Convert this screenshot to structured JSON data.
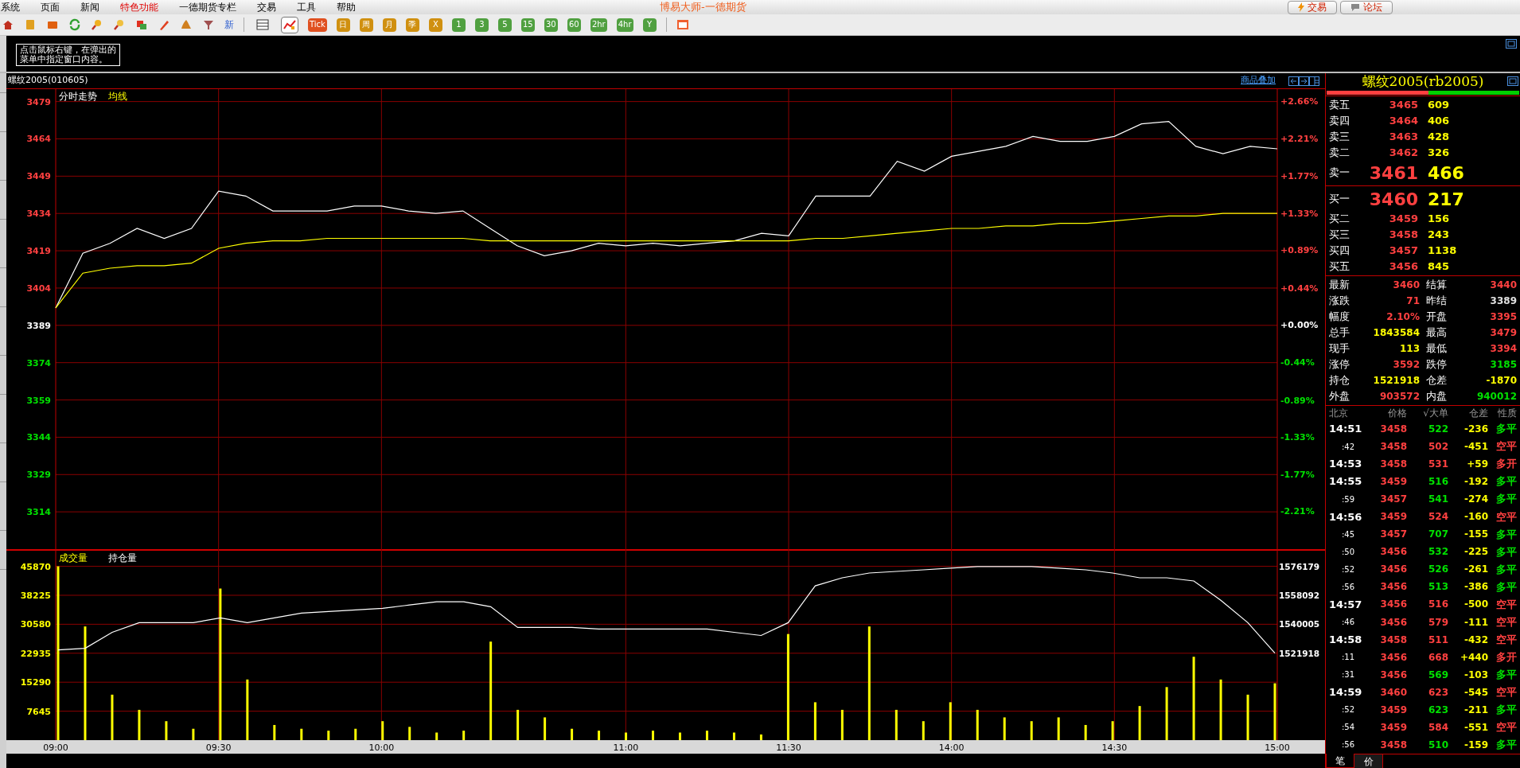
{
  "menu": [
    {
      "label": "系统",
      "highlight": false
    },
    {
      "label": "页面",
      "highlight": false
    },
    {
      "label": "新闻",
      "highlight": false
    },
    {
      "label": "特色功能",
      "highlight": true
    },
    {
      "label": "一德期货专栏",
      "highlight": false
    },
    {
      "label": "交易",
      "highlight": false
    },
    {
      "label": "工具",
      "highlight": false
    },
    {
      "label": "帮助",
      "highlight": false
    }
  ],
  "window": {
    "title": "博易大师-一德期货"
  },
  "top_buttons": [
    {
      "label": "交易",
      "kind": "trade"
    },
    {
      "label": "论坛",
      "kind": "forum"
    }
  ],
  "toolbar": {
    "news_label": "新",
    "views": [
      {
        "selected": false
      },
      {
        "selected": true
      }
    ],
    "periods": [
      {
        "label": "Tick",
        "color": "#e05020"
      },
      {
        "label": "日",
        "color": "#d09010"
      },
      {
        "label": "周",
        "color": "#d09010"
      },
      {
        "label": "月",
        "color": "#d09010"
      },
      {
        "label": "季",
        "color": "#d09010"
      },
      {
        "label": "X",
        "color": "#d09010"
      },
      {
        "label": "1",
        "color": "#50a040"
      },
      {
        "label": "3",
        "color": "#50a040"
      },
      {
        "label": "5",
        "color": "#50a040"
      },
      {
        "label": "15",
        "color": "#50a040"
      },
      {
        "label": "30",
        "color": "#50a040"
      },
      {
        "label": "60",
        "color": "#50a040"
      },
      {
        "label": "2hr",
        "color": "#50a040"
      },
      {
        "label": "4hr",
        "color": "#50a040"
      },
      {
        "label": "Y",
        "color": "#50a040"
      }
    ]
  },
  "tooltip": {
    "lines": [
      "点击鼠标右键，在弹出的",
      "菜单中指定窗口内容。"
    ]
  },
  "chart_header": {
    "title": "螺纹2005(010605)",
    "overlay_link": "商品叠加"
  },
  "price_chart": {
    "chart_data": {
      "type": "line",
      "grid": true,
      "series": [
        {
          "name": "分时走势",
          "color": "#ffffff",
          "values": [
            3396,
            3418,
            3422,
            3428,
            3424,
            3428,
            3443,
            3441,
            3435,
            3435,
            3435,
            3437,
            3437,
            3435,
            3434,
            3435,
            3428,
            3421,
            3417,
            3419,
            3422,
            3421,
            3422,
            3421,
            3422,
            3423,
            3426,
            3425,
            3441,
            3441,
            3441,
            3455,
            3451,
            3457,
            3459,
            3461,
            3465,
            3463,
            3463,
            3465,
            3470,
            3471,
            3461,
            3458,
            3461,
            3460
          ]
        },
        {
          "name": "均线",
          "color": "#ffff00",
          "values": [
            3396,
            3410,
            3412,
            3413,
            3413,
            3414,
            3420,
            3422,
            3423,
            3423,
            3424,
            3424,
            3424,
            3424,
            3424,
            3424,
            3423,
            3423,
            3423,
            3423,
            3423,
            3423,
            3423,
            3423,
            3423,
            3423,
            3423,
            3423,
            3424,
            3424,
            3425,
            3426,
            3427,
            3428,
            3428,
            3429,
            3429,
            3430,
            3430,
            3431,
            3432,
            3433,
            3433,
            3434,
            3434,
            3434
          ]
        }
      ],
      "ylim": [
        3299,
        3484
      ],
      "yticks": [
        3479,
        3464,
        3449,
        3434,
        3419,
        3404,
        3389,
        3374,
        3359,
        3344,
        3329,
        3314
      ],
      "y2lim": [
        -2.66,
        2.8
      ],
      "y2ticks": [
        {
          "value": 2.66,
          "label": "+2.66%"
        },
        {
          "value": 2.21,
          "label": "+2.21%"
        },
        {
          "value": 1.77,
          "label": "+1.77%"
        },
        {
          "value": 1.33,
          "label": "+1.33%"
        },
        {
          "value": 0.89,
          "label": "+0.89%"
        },
        {
          "value": 0.44,
          "label": "+0.44%"
        },
        {
          "value": 0,
          "label": "+0.00%"
        },
        {
          "value": -0.44,
          "label": "-0.44%"
        },
        {
          "value": -0.89,
          "label": "-0.89%"
        },
        {
          "value": -1.33,
          "label": "-1.33%"
        },
        {
          "value": -1.77,
          "label": "-1.77%"
        },
        {
          "value": -2.21,
          "label": "-2.21%"
        }
      ]
    }
  },
  "volume_chart": {
    "chart_data": {
      "type": "bar",
      "grid": true,
      "categories": [
        "09:00",
        null,
        null,
        null,
        null,
        null,
        "09:30",
        null,
        null,
        null,
        null,
        null,
        "10:00",
        null,
        null,
        null,
        null,
        null,
        null,
        null,
        null,
        "11:00",
        null,
        null,
        null,
        null,
        null,
        "11:30",
        null,
        null,
        null,
        null,
        null,
        "14:00",
        null,
        null,
        null,
        null,
        null,
        "14:30",
        null,
        null,
        null,
        null,
        null,
        "15:00"
      ],
      "series": [
        {
          "name": "成交量",
          "color": "#ffff00",
          "type": "bar",
          "values": [
            45870,
            30000,
            12000,
            8000,
            5000,
            3000,
            40000,
            16000,
            4000,
            3000,
            2500,
            3000,
            5000,
            3500,
            2000,
            2500,
            26000,
            8000,
            6000,
            3000,
            2500,
            2000,
            2500,
            2000,
            2500,
            2000,
            1500,
            28000,
            10000,
            8000,
            30000,
            8000,
            5000,
            10000,
            8000,
            6000,
            5000,
            6000,
            4000,
            5000,
            9000,
            14000,
            22000,
            16000,
            12000,
            15000
          ]
        },
        {
          "name": "持仓量",
          "color": "#ffffff",
          "type": "line",
          "axis": "y2",
          "values": [
            1524000,
            1525000,
            1535000,
            1541000,
            1541000,
            1541000,
            1544000,
            1541000,
            1544000,
            1547000,
            1548000,
            1549000,
            1550000,
            1552000,
            1554000,
            1554000,
            1551000,
            1538000,
            1538000,
            1538000,
            1537000,
            1537000,
            1537000,
            1537000,
            1537000,
            1535000,
            1533000,
            1541000,
            1564000,
            1569000,
            1572000,
            1573000,
            1574000,
            1575000,
            1576000,
            1576000,
            1576000,
            1575000,
            1574000,
            1572000,
            1569000,
            1569000,
            1567000,
            1555000,
            1541000,
            1522000
          ]
        }
      ],
      "ylim": [
        0,
        50400
      ],
      "y2lim": [
        1467657,
        1586897
      ],
      "yticks": [
        45870,
        38225,
        30580,
        22935,
        15290,
        7645
      ],
      "y2ticks": [
        1576179,
        1558092,
        1540005,
        1521918
      ]
    }
  },
  "quote": {
    "title": "螺纹2005(rb2005)",
    "ratio_bar": {
      "level": 0.53
    },
    "asks": [
      {
        "label": "卖五",
        "price": "3465",
        "volume": "609",
        "kind": "level"
      },
      {
        "label": "卖四",
        "price": "3464",
        "volume": "406",
        "kind": "level"
      },
      {
        "label": "卖三",
        "price": "3463",
        "volume": "428",
        "kind": "level"
      },
      {
        "label": "卖二",
        "price": "3462",
        "volume": "326",
        "kind": "level"
      },
      {
        "label": "卖一",
        "price": "3461",
        "volume": "466",
        "kind": "best"
      }
    ],
    "bids": [
      {
        "label": "买一",
        "price": "3460",
        "volume": "217",
        "kind": "best"
      },
      {
        "label": "买二",
        "price": "3459",
        "volume": "156",
        "kind": "level"
      },
      {
        "label": "买三",
        "price": "3458",
        "volume": "243",
        "kind": "level"
      },
      {
        "label": "买四",
        "price": "3457",
        "volume": "1138",
        "kind": "level"
      },
      {
        "label": "买五",
        "price": "3456",
        "volume": "845",
        "kind": "level"
      }
    ],
    "stats": [
      {
        "label": "最新",
        "value": "3460",
        "color": "#ff4040"
      },
      {
        "label": "结算",
        "value": "3440",
        "color": "#ff4040"
      },
      {
        "label": "涨跌",
        "value": "71",
        "color": "#ff4040"
      },
      {
        "label": "昨结",
        "value": "3389",
        "color": "#e0e0e0"
      },
      {
        "label": "幅度",
        "value": "2.10%",
        "color": "#ff4040"
      },
      {
        "label": "开盘",
        "value": "3395",
        "color": "#ff4040"
      },
      {
        "label": "总手",
        "value": "1843584",
        "color": "#ffff00"
      },
      {
        "label": "最高",
        "value": "3479",
        "color": "#ff4040"
      },
      {
        "label": "现手",
        "value": "113",
        "color": "#ffff00"
      },
      {
        "label": "最低",
        "value": "3394",
        "color": "#ff4040"
      },
      {
        "label": "涨停",
        "value": "3592",
        "color": "#ff4040"
      },
      {
        "label": "跌停",
        "value": "3185",
        "color": "#00e000"
      },
      {
        "label": "持仓",
        "value": "1521918",
        "color": "#ffff00"
      },
      {
        "label": "仓差",
        "value": "-1870",
        "color": "#ffff00"
      },
      {
        "label": "外盘",
        "value": "903572",
        "color": "#ff4040"
      },
      {
        "label": "内盘",
        "value": "940012",
        "color": "#00e000"
      }
    ],
    "trade_columns": [
      "北京",
      "价格",
      "√大单",
      "仓差",
      "性质"
    ],
    "trades": [
      {
        "time": "14:51",
        "kind": "minute",
        "price": "3458",
        "volume": {
          "text": "522",
          "color": "#00e000"
        },
        "diff": "-236",
        "nature": {
          "text": "多平",
          "color": "#00e000"
        }
      },
      {
        "time": ":42",
        "kind": "second",
        "price": "3458",
        "volume": {
          "text": "502",
          "color": "#ff4040"
        },
        "diff": "-451",
        "nature": {
          "text": "空平",
          "color": "#ff4040"
        }
      },
      {
        "time": "14:53",
        "kind": "minute",
        "price": "3458",
        "volume": {
          "text": "531",
          "color": "#ff4040"
        },
        "diff": "+59",
        "nature": {
          "text": "多开",
          "color": "#ff4040"
        }
      },
      {
        "time": "14:55",
        "kind": "minute",
        "price": "3459",
        "volume": {
          "text": "516",
          "color": "#00e000"
        },
        "diff": "-192",
        "nature": {
          "text": "多平",
          "color": "#00e000"
        }
      },
      {
        "time": ":59",
        "kind": "second",
        "price": "3457",
        "volume": {
          "text": "541",
          "color": "#00e000"
        },
        "diff": "-274",
        "nature": {
          "text": "多平",
          "color": "#00e000"
        }
      },
      {
        "time": "14:56",
        "kind": "minute",
        "price": "3459",
        "volume": {
          "text": "524",
          "color": "#ff4040"
        },
        "diff": "-160",
        "nature": {
          "text": "空平",
          "color": "#ff4040"
        }
      },
      {
        "time": ":45",
        "kind": "second",
        "price": "3457",
        "volume": {
          "text": "707",
          "color": "#00e000"
        },
        "diff": "-155",
        "nature": {
          "text": "多平",
          "color": "#00e000"
        }
      },
      {
        "time": ":50",
        "kind": "second",
        "price": "3456",
        "volume": {
          "text": "532",
          "color": "#00e000"
        },
        "diff": "-225",
        "nature": {
          "text": "多平",
          "color": "#00e000"
        }
      },
      {
        "time": ":52",
        "kind": "second",
        "price": "3456",
        "volume": {
          "text": "526",
          "color": "#00e000"
        },
        "diff": "-261",
        "nature": {
          "text": "多平",
          "color": "#00e000"
        }
      },
      {
        "time": ":56",
        "kind": "second",
        "price": "3456",
        "volume": {
          "text": "513",
          "color": "#00e000"
        },
        "diff": "-386",
        "nature": {
          "text": "多平",
          "color": "#00e000"
        }
      },
      {
        "time": "14:57",
        "kind": "minute",
        "price": "3456",
        "volume": {
          "text": "516",
          "color": "#ff4040"
        },
        "diff": "-500",
        "nature": {
          "text": "空平",
          "color": "#ff4040"
        }
      },
      {
        "time": ":46",
        "kind": "second",
        "price": "3456",
        "volume": {
          "text": "579",
          "color": "#ff4040"
        },
        "diff": "-111",
        "nature": {
          "text": "空平",
          "color": "#ff4040"
        }
      },
      {
        "time": "14:58",
        "kind": "minute",
        "price": "3458",
        "volume": {
          "text": "511",
          "color": "#ff4040"
        },
        "diff": "-432",
        "nature": {
          "text": "空平",
          "color": "#ff4040"
        }
      },
      {
        "time": ":11",
        "kind": "second",
        "price": "3456",
        "volume": {
          "text": "668",
          "color": "#ff4040"
        },
        "diff": "+440",
        "nature": {
          "text": "多开",
          "color": "#ff4040"
        }
      },
      {
        "time": ":31",
        "kind": "second",
        "price": "3456",
        "volume": {
          "text": "569",
          "color": "#00e000"
        },
        "diff": "-103",
        "nature": {
          "text": "多平",
          "color": "#00e000"
        }
      },
      {
        "time": "14:59",
        "kind": "minute",
        "price": "3460",
        "volume": {
          "text": "623",
          "color": "#ff4040"
        },
        "diff": "-545",
        "nature": {
          "text": "空平",
          "color": "#ff4040"
        }
      },
      {
        "time": ":52",
        "kind": "second",
        "price": "3459",
        "volume": {
          "text": "623",
          "color": "#00e000"
        },
        "diff": "-211",
        "nature": {
          "text": "多平",
          "color": "#00e000"
        }
      },
      {
        "time": ":54",
        "kind": "second",
        "price": "3459",
        "volume": {
          "text": "584",
          "color": "#ff4040"
        },
        "diff": "-551",
        "nature": {
          "text": "空平",
          "color": "#ff4040"
        }
      },
      {
        "time": ":56",
        "kind": "second",
        "price": "3458",
        "volume": {
          "text": "510",
          "color": "#00e000"
        },
        "diff": "-159",
        "nature": {
          "text": "多平",
          "color": "#00e000"
        }
      }
    ],
    "tabs": [
      {
        "label": "笔",
        "selected": true
      },
      {
        "label": "价",
        "selected": false
      }
    ]
  }
}
